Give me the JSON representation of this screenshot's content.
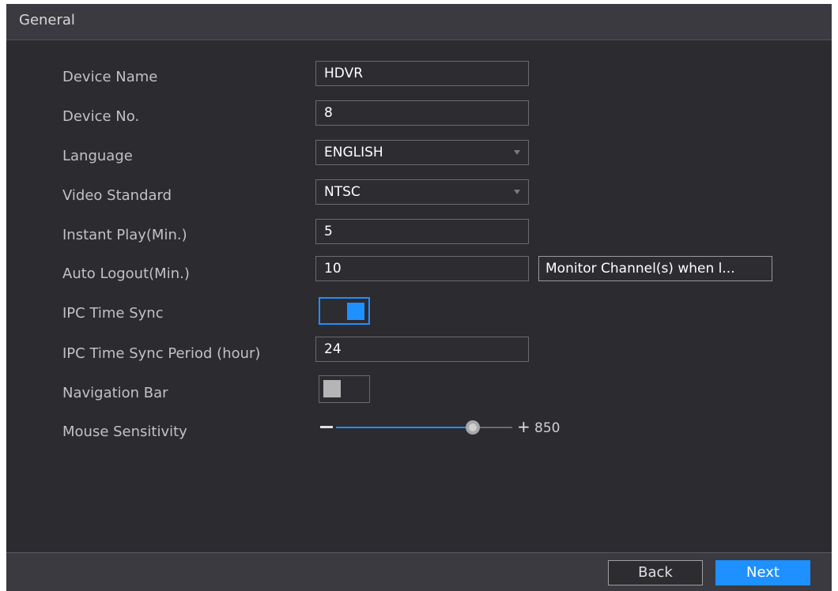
{
  "window": {
    "title": "General"
  },
  "form": {
    "device_name": {
      "label": "Device Name",
      "value": "HDVR"
    },
    "device_no": {
      "label": "Device No.",
      "value": "8"
    },
    "language": {
      "label": "Language",
      "value": "ENGLISH"
    },
    "video_standard": {
      "label": "Video Standard",
      "value": "NTSC"
    },
    "instant_play": {
      "label": "Instant Play(Min.)",
      "value": "5"
    },
    "auto_logout": {
      "label": "Auto Logout(Min.)",
      "value": "10",
      "monitor_button": "Monitor Channel(s) when l..."
    },
    "ipc_time_sync": {
      "label": "IPC Time Sync",
      "enabled": true
    },
    "ipc_time_sync_period": {
      "label": "IPC Time Sync Period (hour)",
      "value": "24"
    },
    "navigation_bar": {
      "label": "Navigation Bar",
      "enabled": false
    },
    "mouse_sensitivity": {
      "label": "Mouse Sensitivity",
      "value": "850",
      "minus": "−",
      "plus": "+"
    }
  },
  "footer": {
    "back_label": "Back",
    "next_label": "Next"
  },
  "colors": {
    "accent": "#1e90ff",
    "background": "#2b2b30",
    "titlebar": "#3a3a40"
  }
}
